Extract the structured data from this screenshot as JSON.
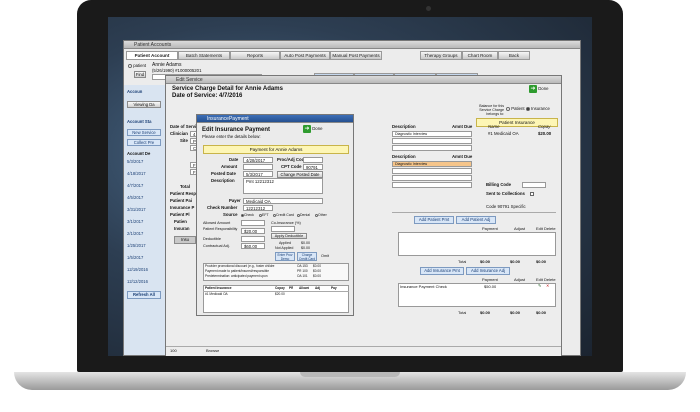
{
  "main_window": {
    "title": "Patient Accounts",
    "tabs": [
      {
        "label": "Patient Account"
      },
      {
        "label": "Batch Statements"
      },
      {
        "label": "Reports"
      },
      {
        "label": "Auto Post Payments"
      },
      {
        "label": "Manual Post Payments"
      },
      {
        "label": "Therapy Groups"
      },
      {
        "label": "Chart Room"
      },
      {
        "label": "Back"
      }
    ],
    "patient_label": "patient",
    "find_label": "Find",
    "patient_name": "Annie Adams",
    "patient_sub": "(5/26/1990) #1000005201",
    "subtabs": [
      {
        "label": "Chart Face"
      },
      {
        "label": "Demographics"
      },
      {
        "label": "Make Appointment"
      },
      {
        "label": "Internal Message"
      }
    ],
    "sidebar": {
      "account_label": "Accoun",
      "viewing": "Viewing Da",
      "account_short": "Account Sta",
      "new_service": "New Service",
      "collect": "Collect Pre",
      "account_details": "Account De",
      "dates": [
        "5/3/2017",
        "4/18/2017",
        "4/7/2017",
        "4/5/2017",
        "3/31/2017",
        "3/1/2017",
        "2/1/2017",
        "1/25/2017",
        "1/5/2017",
        "12/19/2016",
        "12/12/2016"
      ],
      "refresh": "Refresh All"
    }
  },
  "edit_service_window": {
    "title": "Edit Service",
    "heading": "Service Charge Detail for Annie Adams",
    "date_of_service": "Date of Service: 4/7/2016",
    "done_label": "Done",
    "balance_label": "Balance for this Service Charge belongs to:",
    "patient_option": "Patient",
    "insurance_option": "Insurance",
    "patient_insurance_band": "Patient Insurance",
    "left_labels": [
      "Date of Service",
      "Clinician",
      "Site",
      "Total",
      "Patient Resp",
      "Patient Pai",
      "Insurance P",
      "Patient Pl",
      "Patien",
      "Insuran"
    ],
    "left_values": [
      "4",
      "P",
      "C",
      "F1",
      "F2"
    ],
    "desc_header": "Description",
    "amt_header": "Amnt Due",
    "desc_row": "Diagnostic Interview",
    "payer_header_name": "Name",
    "payer_header_copay": "Copay",
    "payer_row_name": "#1 Medicaid OA",
    "payer_row_copay": "$20.00",
    "desc_header2": "Description",
    "amt_header2": "Amnt Due",
    "desc_row2": "Diagnostic Interview",
    "billing_code": "Billing Code",
    "sent_to_collections": "Sent to Collections",
    "code_text": "Code 90791 Specific",
    "add_patient_pmt": "Add Patient Pmt",
    "add_patient_adj": "Add Patient Adj",
    "pay_cols": [
      "Payment",
      "Adjust",
      "Edit Delete"
    ],
    "total_label": "Total",
    "total_values": [
      "$0.00",
      "$0.00",
      "$0.00"
    ],
    "add_insurance_pmt": "Add Insurance Pmt",
    "add_insurance_adj": "Add Insurance Adj",
    "ins_row": "Insurance Payment Check",
    "ins_row_amt": "$50.00",
    "total_values2": [
      "$0.00",
      "$0.00",
      "$0.00"
    ],
    "bottom_btn": "Insu",
    "status_bar": "100",
    "browse": "Browse"
  },
  "insurance_payment_window": {
    "title": "InsurancePayment",
    "heading": "Edit Insurance Payment",
    "subheading": "Please enter the details below:",
    "done_label": "Done",
    "payment_band": "Payment for Annie Adams",
    "date_label": "Date",
    "date_value": "4/28/2017",
    "amount_label": "Amount",
    "posted_date_label": "Posted Date",
    "posted_date_value": "5/3/2017",
    "description_label": "Description",
    "description_value": "Pmt 12212312",
    "payer_label": "Payer",
    "payer_value": "Medicaid OA",
    "check_number_label": "Check Number",
    "check_number_value": "12212312",
    "source_label": "Source",
    "source_options": [
      "Check",
      "EFT",
      "Credit Card",
      "Denial",
      "Other"
    ],
    "proc_adj_code_label": "Proc/Adj Code",
    "cpt_code_label": "CPT Code",
    "cpt_code_value": "90791",
    "change_posted_date": "Change Posted Date",
    "allowed_amount_label": "Allowed Amount",
    "patient_resp_label": "Patient Responsibility",
    "patient_resp_value": "$20.00",
    "deductible_label": "Deductible",
    "contractual_adj_label": "Contractual Adj.",
    "contractual_adj_value": "$60.00",
    "coinsurance_label": "Co-Insurance (%)",
    "apply_deductible": "Apply Deductible",
    "applied_label": "Applied",
    "applied_value": "$0.00",
    "not_applied_label": "Not Applied",
    "not_applied_value": "$0.00",
    "enter_prov_demo": "Enter Prov Demo",
    "charge_credit_card": "Charge Credit Card",
    "omit_label": "Omit",
    "promo_lines": [
      "Provider promotional discount (e.g., foster childre",
      "Payment made to patient/insured/responsible",
      "Predetermination: anticipated payment upon"
    ],
    "promo_codes": [
      "OA 153",
      "PR 100",
      "OA 101"
    ],
    "promo_amounts": [
      "$0.00",
      "$0.00",
      "$0.00"
    ],
    "ins_table_headers": [
      "Patient Insurance",
      "Copay",
      "PR",
      "Allowd",
      "Adj",
      "Pay"
    ],
    "ins_table_row": [
      "#1 Medicaid OA",
      "$20.00"
    ]
  }
}
